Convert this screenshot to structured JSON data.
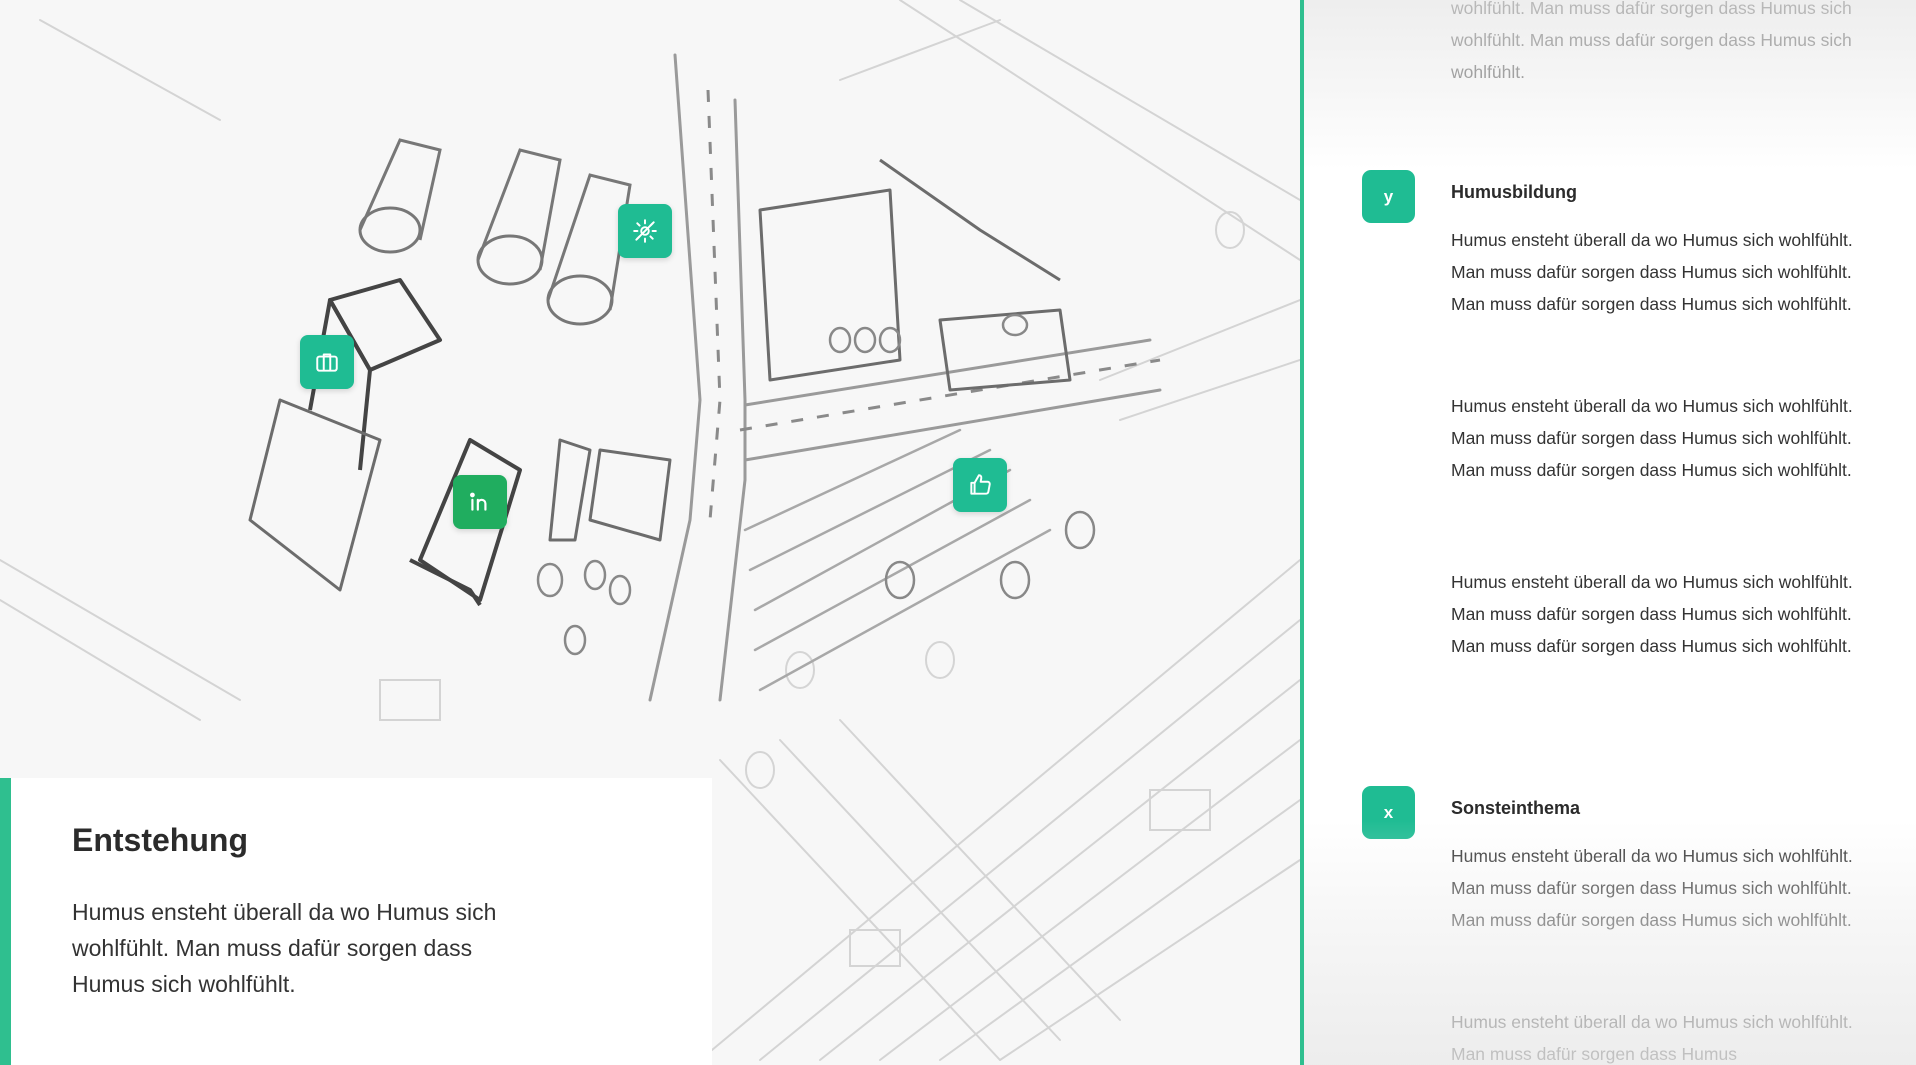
{
  "map": {
    "markers": [
      {
        "name": "marker-no-sun",
        "icon": "no-sun-icon"
      },
      {
        "name": "marker-briefcase",
        "icon": "briefcase-icon"
      },
      {
        "name": "marker-linkedin",
        "icon": "linkedin-icon"
      },
      {
        "name": "marker-thumbs-up",
        "icon": "thumbs-up-icon"
      }
    ],
    "colors": {
      "marker": "#1fbc93",
      "marker_dark": "#20ad5f",
      "accent": "#2fbf8f"
    }
  },
  "info_card": {
    "title": "Entstehung",
    "body": "Humus ensteht überall da wo Humus sich wohlfühlt. Man muss dafür sorgen dass Humus sich wohlfühlt."
  },
  "panel": {
    "top_paragraph": "wohlfühlt. Man muss dafür sorgen dass Humus sich wohlfühlt. Man muss dafür sorgen dass Humus sich wohlfühlt.",
    "sections": [
      {
        "badge": "y",
        "title": "Humusbildung",
        "paragraphs": [
          "Humus ensteht überall da wo Humus sich wohlfühlt. Man muss dafür sorgen dass Humus sich wohlfühlt. Man muss dafür sorgen dass Humus sich wohlfühlt.",
          "Humus ensteht überall da wo Humus sich wohlfühlt. Man muss dafür sorgen dass Humus sich wohlfühlt. Man muss dafür sorgen dass Humus sich wohlfühlt.",
          "Humus ensteht überall da wo Humus sich wohlfühlt. Man muss dafür sorgen dass Humus sich wohlfühlt. Man muss dafür sorgen dass Humus sich wohlfühlt."
        ]
      },
      {
        "badge": "x",
        "title": "Sonsteinthema",
        "paragraphs": [
          "Humus ensteht überall da wo Humus sich wohlfühlt. Man muss dafür sorgen dass Humus sich wohlfühlt. Man muss dafür sorgen dass Humus sich wohlfühlt.",
          "Humus ensteht überall da wo Humus sich wohlfühlt. Man muss dafür sorgen dass Humus"
        ]
      }
    ]
  }
}
